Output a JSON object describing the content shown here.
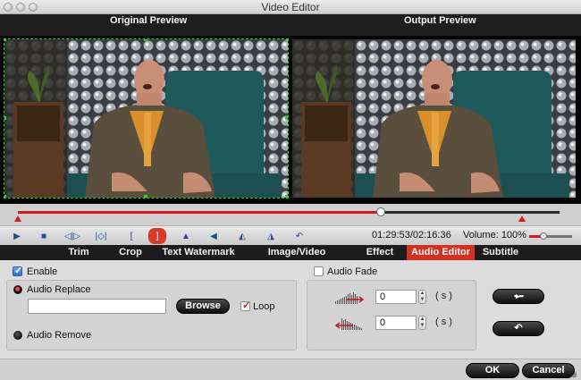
{
  "window": {
    "title": "Video Editor"
  },
  "preview": {
    "original_label": "Original Preview",
    "output_label": "Output Preview"
  },
  "timeline": {
    "progress": 0.67
  },
  "toolbar": {
    "timecode": "01:29:53/02:16:36",
    "volume_label": "Volume:",
    "volume_value": "100%",
    "volume_level": 0.33,
    "buttons": [
      "play-icon",
      "stop-icon",
      "prev-frame-icon",
      "next-frame-icon",
      "mark-in-icon",
      "mark-out-icon",
      "flip-horizontal-icon",
      "flip-left-icon",
      "rotate-left-icon",
      "rotate-right-icon",
      "undo-icon"
    ]
  },
  "tabs": [
    {
      "label": "Trim",
      "active": false
    },
    {
      "label": "Crop",
      "active": false
    },
    {
      "label": "Text Watermark",
      "active": false
    },
    {
      "label": "Image/Video Watermark",
      "active": false
    },
    {
      "label": "Effect",
      "active": false
    },
    {
      "label": "Audio Editor",
      "active": true
    },
    {
      "label": "Subtitle",
      "active": false
    }
  ],
  "audio_editor": {
    "enable_label": "Enable",
    "enable_checked": true,
    "audio_replace_label": "Audio Replace",
    "audio_replace_path": "",
    "browse_label": "Browse",
    "loop_label": "Loop",
    "loop_checked": true,
    "audio_remove_label": "Audio Remove",
    "audio_fade_label": "Audio Fade",
    "audio_fade_checked": false,
    "fade_in_value": "0",
    "fade_out_value": "0",
    "fade_unit": "( s )"
  },
  "footer": {
    "ok_label": "OK",
    "cancel_label": "Cancel"
  },
  "colors": {
    "accent_red": "#d5301f",
    "toolbar_blue": "#2a4a8c",
    "crop_green": "#2fd12f"
  }
}
